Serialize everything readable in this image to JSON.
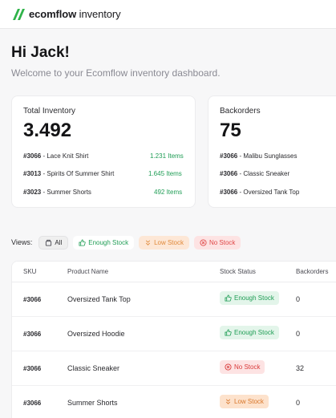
{
  "brand": {
    "name_bold": "ecomflow",
    "name_light": " inventory",
    "color": "#2fb34a"
  },
  "greeting": "Hi Jack!",
  "subtitle": "Welcome to your Ecomflow inventory dashboard.",
  "total_inventory": {
    "title": "Total Inventory",
    "value": "3.492",
    "rows": [
      {
        "sku": "#3066",
        "name": " - Lace Knit Shirt",
        "qty": "1.231 Items"
      },
      {
        "sku": "#3013",
        "name": " - Spirits Of Summer Shirt",
        "qty": "1.645 Items"
      },
      {
        "sku": "#3023",
        "name": " - Summer Shorts",
        "qty": "492 Items"
      }
    ]
  },
  "backorders": {
    "title": "Backorders",
    "value": "75",
    "rows": [
      {
        "sku": "#3066",
        "name": " - Malibu Sunglasses"
      },
      {
        "sku": "#3066",
        "name": " - Classic Sneaker"
      },
      {
        "sku": "#3066",
        "name": " - Oversized Tank Top"
      }
    ]
  },
  "views": {
    "label": "Views:",
    "filters": [
      {
        "label": "All",
        "icon": "box-icon"
      },
      {
        "label": "Enough Stock",
        "icon": "thumbs-up-icon"
      },
      {
        "label": "Low Stock",
        "icon": "chevrons-down-icon"
      },
      {
        "label": "No Stock",
        "icon": "x-circle-icon"
      }
    ]
  },
  "table": {
    "columns": [
      "SKU",
      "Product Name",
      "Stock Status",
      "Backorders"
    ],
    "rows": [
      {
        "sku": "#3066",
        "product": "Oversized Tank Top",
        "status": "Enough Stock",
        "status_type": "enough",
        "backorders": "0"
      },
      {
        "sku": "#3066",
        "product": "Oversized Hoodie",
        "status": "Enough Stock",
        "status_type": "enough",
        "backorders": "0"
      },
      {
        "sku": "#3066",
        "product": "Classic Sneaker",
        "status": "No Stock",
        "status_type": "none",
        "backorders": "32"
      },
      {
        "sku": "#3066",
        "product": "Summer Shorts",
        "status": "Low Stock",
        "status_type": "low",
        "backorders": "0"
      }
    ]
  },
  "colors": {
    "enough": "#1f9d55",
    "low": "#d9782c",
    "none": "#d93b3b"
  }
}
